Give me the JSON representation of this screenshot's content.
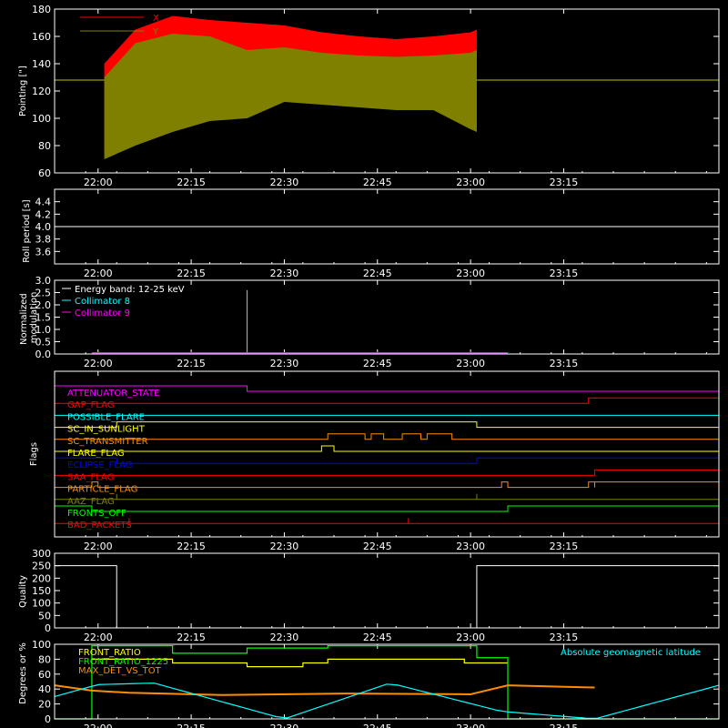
{
  "x_ticks": [
    "22:00",
    "22:15",
    "22:30",
    "22:45",
    "23:00",
    "23:15"
  ],
  "chart_data": [
    {
      "type": "area",
      "ylabel": "Pointing [\"]",
      "ylim": [
        60,
        180
      ],
      "yticks": [
        60,
        80,
        100,
        120,
        140,
        160,
        180
      ],
      "series": [
        {
          "name": "X",
          "color": "#ff0000"
        },
        {
          "name": "Y",
          "color": "#808000"
        }
      ],
      "data_window": [
        "22:01",
        "23:01"
      ],
      "x_envelope": {
        "x": [
          "22:01",
          "22:06",
          "22:12",
          "22:18",
          "22:24",
          "22:30",
          "22:36",
          "22:42",
          "22:48",
          "22:54",
          "23:00",
          "23:01"
        ],
        "upper": [
          140,
          165,
          175,
          172,
          170,
          168,
          163,
          160,
          158,
          160,
          163,
          165
        ],
        "lower": [
          75,
          88,
          98,
          105,
          108,
          118,
          115,
          113,
          112,
          112,
          95,
          90
        ]
      },
      "y_envelope": {
        "x": [
          "22:01",
          "22:06",
          "22:12",
          "22:18",
          "22:24",
          "22:30",
          "22:36",
          "22:42",
          "22:48",
          "22:54",
          "23:00",
          "23:01"
        ],
        "upper": [
          130,
          155,
          162,
          160,
          150,
          152,
          148,
          146,
          145,
          146,
          148,
          150
        ],
        "lower": [
          70,
          80,
          90,
          98,
          100,
          112,
          110,
          108,
          106,
          106,
          92,
          90
        ]
      },
      "reference_level": 128
    },
    {
      "type": "line",
      "ylabel": "Roll period [s]",
      "ylim": [
        3.4,
        4.6
      ],
      "yticks": [
        3.6,
        3.8,
        4.0,
        4.2,
        4.4
      ],
      "series": [
        {
          "x": [
            "21:53",
            "23:40"
          ],
          "values": [
            4.0,
            4.0
          ],
          "color": "#ffffff"
        }
      ]
    },
    {
      "type": "line",
      "ylabel": "Normalized modulation",
      "ylim": [
        0,
        3.0
      ],
      "yticks": [
        0.0,
        0.5,
        1.0,
        1.5,
        2.0,
        2.5,
        3.0
      ],
      "legend": {
        "text": "Energy band: 12-25 keV"
      },
      "series": [
        {
          "name": "Collimator 8",
          "color": "#00ffff",
          "baseline": 0.05,
          "spike": {
            "x": "22:24",
            "value": 2.6
          }
        },
        {
          "name": "Collimator 9",
          "color": "#ff00ff",
          "baseline": 0.05
        }
      ],
      "data_window": [
        "21:59",
        "23:06"
      ]
    },
    {
      "type": "line",
      "ylabel": "Flags",
      "flags": [
        {
          "name": "ATTENUATOR_STATE",
          "color": "#ff00ff",
          "steps": [
            [
              "21:53",
              1
            ],
            [
              "22:24",
              0
            ]
          ]
        },
        {
          "name": "GAP_FLAG",
          "color": "#ff0000",
          "steps": [
            [
              "21:53",
              0
            ],
            [
              "23:19",
              1
            ]
          ]
        },
        {
          "name": "POSSIBLE_FLARE",
          "color": "#00ffff",
          "steps": [
            [
              "21:53",
              0
            ]
          ]
        },
        {
          "name": "SC_IN_SUNLIGHT",
          "color": "#ffff00",
          "steps": [
            [
              "21:53",
              0
            ],
            [
              "22:03",
              1
            ],
            [
              "23:01",
              0
            ]
          ]
        },
        {
          "name": "SC_TRANSMITTER",
          "color": "#ff8c00",
          "steps": [
            [
              "21:53",
              0
            ],
            [
              "22:37",
              1
            ],
            [
              "22:43",
              0
            ],
            [
              "22:44",
              1
            ],
            [
              "22:46",
              0
            ],
            [
              "22:49",
              1
            ],
            [
              "22:52",
              0
            ],
            [
              "22:53",
              1
            ],
            [
              "22:57",
              0
            ]
          ]
        },
        {
          "name": "FLARE_FLAG",
          "color": "#ffff00",
          "steps": [
            [
              "21:53",
              0
            ],
            [
              "22:36",
              1
            ],
            [
              "22:38",
              0
            ]
          ]
        },
        {
          "name": "ECLIPSE_FLAG",
          "color": "#0000ff",
          "steps": [
            [
              "21:53",
              1
            ],
            [
              "22:03",
              0
            ],
            [
              "23:01",
              1
            ]
          ]
        },
        {
          "name": "SAA_FLAG",
          "color": "#ff0000",
          "steps": [
            [
              "21:53",
              0
            ],
            [
              "23:20",
              1
            ]
          ]
        },
        {
          "name": "PARTICLE_FLAG",
          "color": "#ff8c00",
          "steps": [
            [
              "21:53",
              0
            ],
            [
              "21:59",
              1
            ],
            [
              "22:00",
              0
            ],
            [
              "23:05",
              1
            ],
            [
              "23:06",
              0
            ],
            [
              "23:19",
              1
            ],
            [
              "23:20",
              0
            ],
            [
              "23:20",
              1
            ]
          ]
        },
        {
          "name": "AAZ_FLAG",
          "color": "#808000",
          "steps": [
            [
              "21:53",
              0
            ],
            [
              "22:03",
              1
            ],
            [
              "22:03",
              0
            ],
            [
              "23:01",
              1
            ],
            [
              "23:01",
              0
            ]
          ]
        },
        {
          "name": "FRONTS_OFF",
          "color": "#00ff00",
          "steps": [
            [
              "21:53",
              1
            ],
            [
              "21:59",
              0
            ],
            [
              "23:06",
              1
            ]
          ]
        },
        {
          "name": "BAD_PACKETS",
          "color": "#ff0000",
          "steps": [
            [
              "21:53",
              0
            ],
            [
              "22:05",
              1
            ],
            [
              "22:05",
              0
            ],
            [
              "22:50",
              1
            ],
            [
              "22:50",
              0
            ]
          ]
        }
      ]
    },
    {
      "type": "line",
      "ylabel": "Quality",
      "ylim": [
        0,
        300
      ],
      "yticks": [
        0,
        50,
        100,
        150,
        200,
        250,
        300
      ],
      "series": [
        {
          "x": [
            "21:53",
            "22:03",
            "22:03",
            "23:01",
            "23:01",
            "23:40"
          ],
          "values": [
            250,
            250,
            0,
            0,
            250,
            250
          ],
          "color": "#ffffff"
        }
      ]
    },
    {
      "type": "line",
      "ylabel": "Degrees or %",
      "ylim": [
        0,
        100
      ],
      "yticks": [
        0,
        20,
        40,
        60,
        80,
        100
      ],
      "annotations": [
        {
          "text": "FRONT_RATIO",
          "color": "#ffff00"
        },
        {
          "text": "FRONT_RATIO_1225",
          "color": "#00ff00"
        },
        {
          "text": "MAX_DET_VS_TOT",
          "color": "#ff8c00"
        },
        {
          "text": "Absolute geomagnetic latitude",
          "color": "#00ffff"
        }
      ],
      "series": [
        {
          "name": "FRONT_RATIO",
          "color": "#ffff00",
          "x": [
            "21:59",
            "22:12",
            "22:12",
            "22:24",
            "22:24",
            "22:33",
            "22:33",
            "22:37",
            "22:37",
            "22:59",
            "22:59",
            "23:06"
          ],
          "values": [
            80,
            80,
            75,
            75,
            70,
            70,
            75,
            75,
            80,
            80,
            75,
            75
          ]
        },
        {
          "name": "FRONT_RATIO_1225",
          "color": "#00ff00",
          "x": [
            "21:53",
            "21:59",
            "21:59",
            "22:12",
            "22:12",
            "22:24",
            "22:24",
            "22:37",
            "22:37",
            "23:01",
            "23:01",
            "23:06",
            "23:06",
            "23:40"
          ],
          "values": [
            0,
            0,
            98,
            98,
            88,
            88,
            95,
            95,
            98,
            98,
            82,
            82,
            0,
            0
          ]
        },
        {
          "name": "MAX_DET_VS_TOT",
          "color": "#ff8c00",
          "x": [
            "21:53",
            "21:59",
            "22:05",
            "22:20",
            "22:40",
            "23:00",
            "23:06",
            "23:20"
          ],
          "values": [
            45,
            38,
            35,
            32,
            34,
            33,
            45,
            42
          ]
        },
        {
          "name": "Absolute geomagnetic latitude",
          "color": "#00ffff",
          "x": [
            "21:53",
            "22:00",
            "22:09",
            "22:30",
            "22:47",
            "23:05",
            "23:20",
            "23:40"
          ],
          "values": [
            30,
            46,
            48,
            0,
            48,
            10,
            0,
            45
          ]
        }
      ]
    }
  ]
}
